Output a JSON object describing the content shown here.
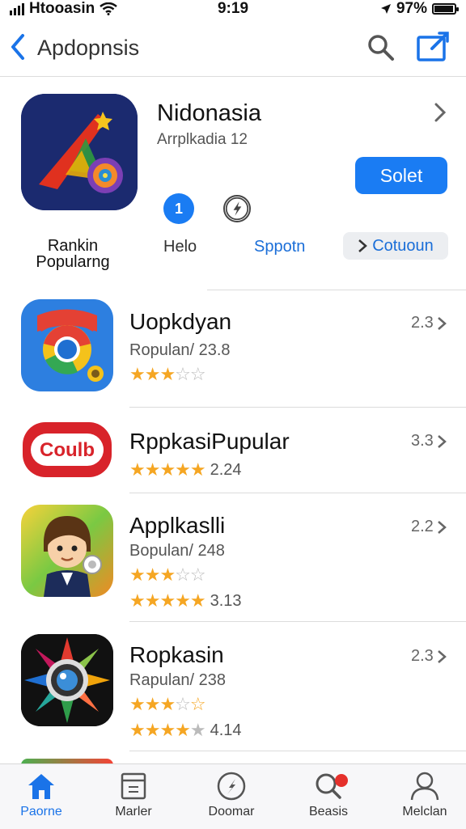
{
  "status_bar": {
    "carrier": "Htooasin",
    "time": "9:19",
    "battery_text": "97%",
    "battery_level": 0.97
  },
  "nav": {
    "title": "Apdopnsis",
    "back_icon": "chevron-left-icon",
    "search_icon": "search-icon",
    "compose_icon": "compose-icon"
  },
  "featured": {
    "name": "Nidonasia",
    "subtitle": "Arrplkadia 12",
    "get_label": "Solet",
    "info_button_text": "1",
    "label_ranking": "Rankin Popularng",
    "label_help": "Helo",
    "label_sponsor": "Sppotn",
    "pill_label": "Cotuoun"
  },
  "apps": [
    {
      "name": "Uopkdyan",
      "subtitle": "Ropulan/ 23.8",
      "rank": "2.3",
      "stars": 3,
      "star_text": ""
    },
    {
      "name": "RppkasiPupular",
      "subtitle": "",
      "rank": "3.3",
      "stars": 5,
      "star_text": "2.24",
      "icon_text": "Coulb"
    },
    {
      "name": "Applkaslli",
      "subtitle": "Bopulan/ 248",
      "rank": "2.2",
      "stars": 3,
      "star_text": "",
      "stars2": 5,
      "star_text2": "3.13"
    },
    {
      "name": "Ropkasin",
      "subtitle": "Rapulan/ 238",
      "rank": "2.3",
      "stars": 3,
      "star_text": "",
      "stars2": 4,
      "star_text2": "4.14"
    }
  ],
  "tabs": [
    {
      "label": "Paorne",
      "icon": "home-icon",
      "active": true
    },
    {
      "label": "Marler",
      "icon": "calendar-icon",
      "active": false
    },
    {
      "label": "Doomar",
      "icon": "compass-icon",
      "active": false
    },
    {
      "label": "Beasis",
      "icon": "search-icon",
      "active": false
    },
    {
      "label": "Melclan",
      "icon": "person-icon",
      "active": false
    }
  ],
  "colors": {
    "accent": "#1a7cf3",
    "star": "#f5a623",
    "badge": "#e5302b"
  }
}
